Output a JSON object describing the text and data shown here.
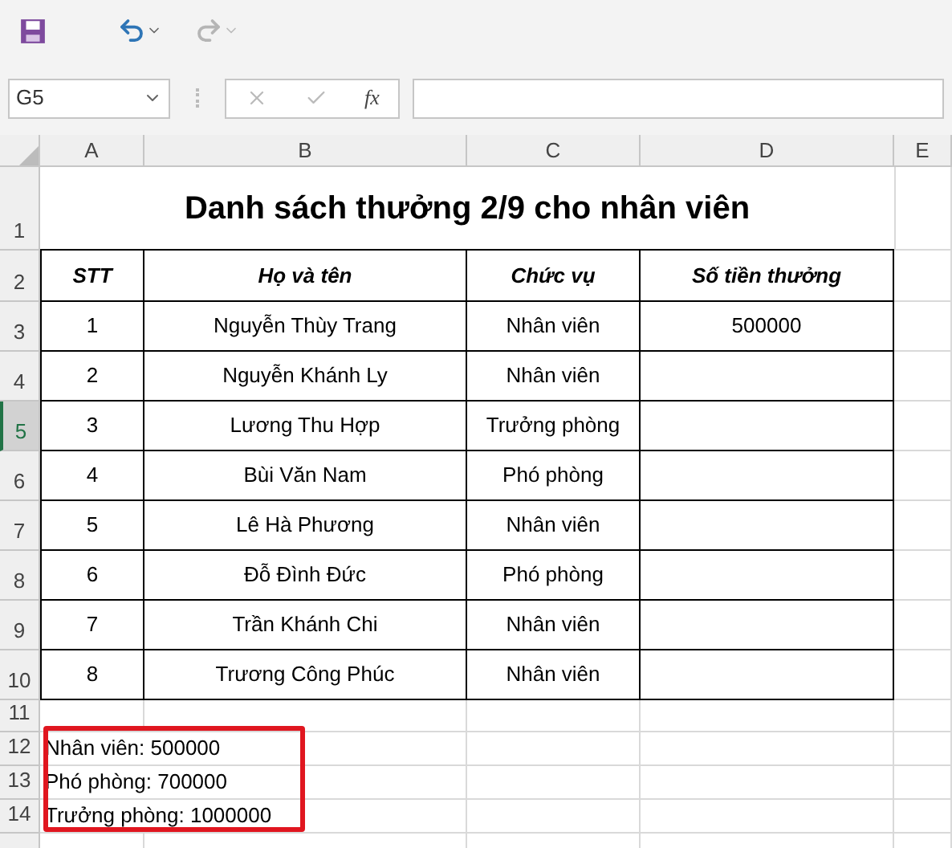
{
  "name_box": "G5",
  "formula_icon": "fx",
  "columns": [
    "A",
    "B",
    "C",
    "D",
    "E"
  ],
  "title": {
    "row": "1",
    "text": "Danh sách thưởng 2/9 cho nhân viên"
  },
  "table": {
    "header_row": "2",
    "headers": [
      "STT",
      "Họ và tên",
      "Chức vụ",
      "Số tiền thưởng"
    ],
    "rows": [
      {
        "row": "3",
        "selected": false,
        "cells": [
          "1",
          "Nguyễn Thùy Trang",
          "Nhân viên",
          "500000"
        ]
      },
      {
        "row": "4",
        "selected": false,
        "cells": [
          "2",
          "Nguyễn Khánh Ly",
          "Nhân viên",
          ""
        ]
      },
      {
        "row": "5",
        "selected": true,
        "cells": [
          "3",
          "Lương Thu Hợp",
          "Trưởng phòng",
          ""
        ]
      },
      {
        "row": "6",
        "selected": false,
        "cells": [
          "4",
          "Bùi Văn Nam",
          "Phó phòng",
          ""
        ]
      },
      {
        "row": "7",
        "selected": false,
        "cells": [
          "5",
          "Lê Hà Phương",
          "Nhân viên",
          ""
        ]
      },
      {
        "row": "8",
        "selected": false,
        "cells": [
          "6",
          "Đỗ Đình Đức",
          "Phó phòng",
          ""
        ]
      },
      {
        "row": "9",
        "selected": false,
        "cells": [
          "7",
          "Trần Khánh Chi",
          "Nhân viên",
          ""
        ]
      },
      {
        "row": "10",
        "selected": false,
        "cells": [
          "8",
          "Trương Công Phúc",
          "Nhân viên",
          ""
        ]
      }
    ]
  },
  "empty_row": "11",
  "notes": [
    {
      "row": "12",
      "text": "Nhân viên: 500000"
    },
    {
      "row": "13",
      "text": "Phó phòng: 700000"
    },
    {
      "row": "14",
      "text": "Trưởng phòng: 1000000"
    }
  ]
}
